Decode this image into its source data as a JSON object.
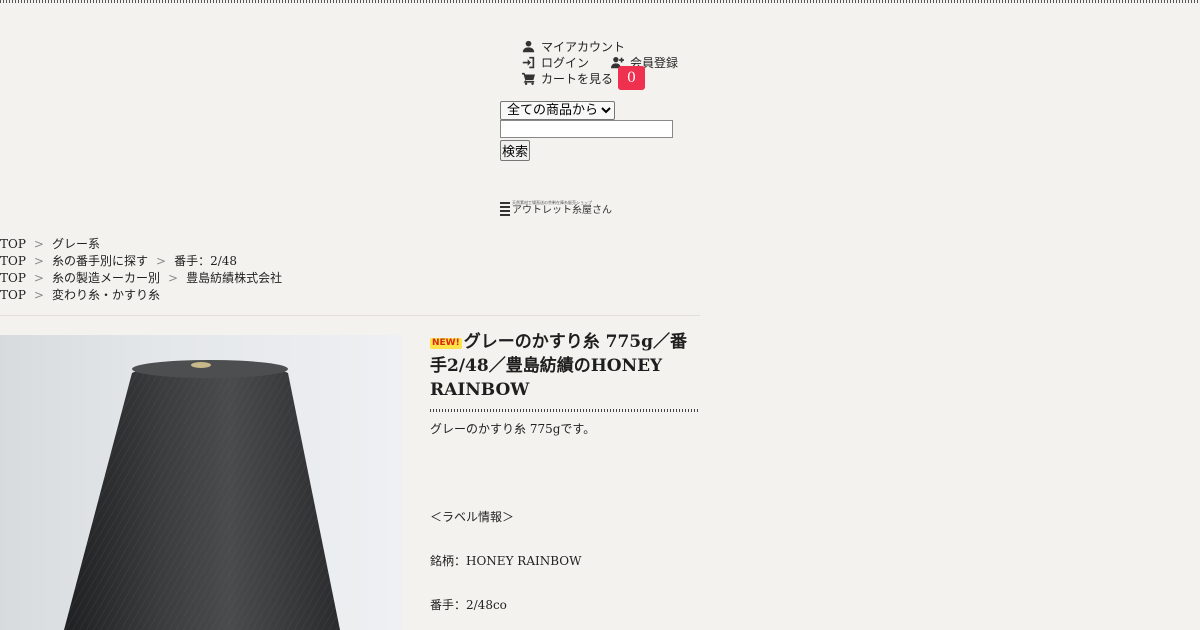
{
  "header": {
    "my_account": "マイアカウント",
    "login": "ログイン",
    "register": "会員登録",
    "cart": "カートを見る",
    "cart_count": "0",
    "accent_color": "#f0304f"
  },
  "search": {
    "category_selected": "全ての商品から",
    "query_value": "",
    "button_label": "検索"
  },
  "logo": {
    "tagline": "天然素材工場直送の余剰在庫糸販売ショップ",
    "name": "アウトレット糸屋さん"
  },
  "breadcrumbs": [
    [
      "TOP",
      "グレー系"
    ],
    [
      "TOP",
      "糸の番手別に探す",
      "番手：2/48"
    ],
    [
      "TOP",
      "糸の製造メーカー別",
      "豊島紡績株式会社"
    ],
    [
      "TOP",
      "変わり糸・かすり糸"
    ]
  ],
  "breadcrumb_separator": ">",
  "product": {
    "new_badge": "NEW!",
    "title": "グレーのかすり糸 775g／番手2/48／豊島紡績のHONEY RAINBOW",
    "description": "グレーのかすり糸 775gです。",
    "label_heading": "＜ラベル情報＞",
    "brand": "銘柄：HONEY RAINBOW",
    "count": "番手：2/48co",
    "image_subject": "dark grey yarn cone"
  },
  "icons": {
    "account": "user-icon",
    "login": "login-icon",
    "register": "user-plus-icon",
    "cart": "cart-icon"
  }
}
